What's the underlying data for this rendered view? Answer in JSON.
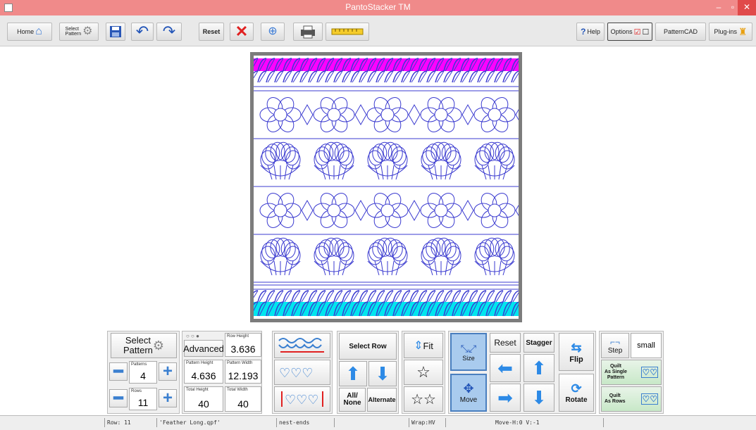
{
  "window": {
    "title": "PantoStacker TM"
  },
  "toolbar": {
    "home": "Home",
    "select_pattern_line1": "Select",
    "select_pattern_line2": "Pattern",
    "reset": "Reset",
    "help": "Help",
    "options": "Options",
    "patterncad": "PatternCAD",
    "plugins": "Plug-ins"
  },
  "controls": {
    "select_pattern_line1": "Select",
    "select_pattern_line2": "Pattern",
    "patterns_label": "Patterns",
    "patterns_value": "4",
    "rows_label": "Rows",
    "rows_value": "11",
    "advanced": "Advanced",
    "row_height_label": "Row Height",
    "row_height_value": "3.636",
    "pattern_height_label": "Pattern Height",
    "pattern_height_value": "4.636",
    "pattern_width_label": "Pattern Width",
    "pattern_width_value": "12.193",
    "total_height_label": "Total Height",
    "total_height_value": "40",
    "total_width_label": "Total Width",
    "total_width_value": "40",
    "select_row": "Select Row",
    "all_none_line1": "All/",
    "all_none_line2": "None",
    "alternate": "Alternate",
    "fit": "Fit",
    "size": "Size",
    "move": "Move",
    "reset": "Reset",
    "stagger": "Stagger",
    "flip": "Flip",
    "rotate": "Rotate",
    "step": "Step",
    "step_value": "small",
    "quilt_single_line1": "Quilt",
    "quilt_single_line2": "As Single",
    "quilt_single_line3": "Pattern",
    "quilt_rows_line1": "Quilt",
    "quilt_rows_line2": "As Rows"
  },
  "status": {
    "row": "Row: 11",
    "file": "'Feather Long.qpf'",
    "mode": "nest-ends",
    "wrap": "Wrap:HV",
    "move": "Move-H:0 V:-1"
  },
  "colors": {
    "title_bar": "#f08a8a",
    "magenta_row": "#ff00ff",
    "cyan_row": "#00e5ee",
    "pattern_line": "#3b3bd0"
  }
}
